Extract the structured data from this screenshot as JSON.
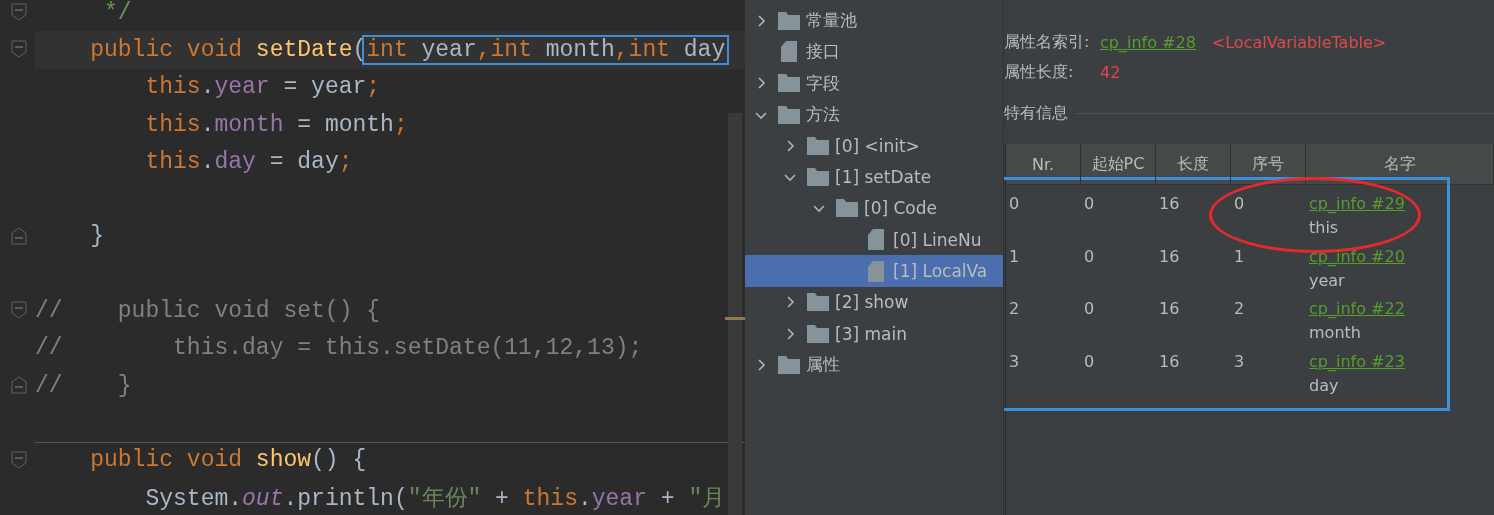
{
  "editor": {
    "lines": [
      {
        "kind": "code",
        "fold_start": true,
        "tokens": [
          {
            "text": "     */",
            "kind": "doc"
          }
        ]
      },
      {
        "kind": "code",
        "fold_start": true,
        "current": true,
        "tokens": [
          {
            "text": "    public void ",
            "kind": "keyword"
          },
          {
            "text": "setDate",
            "kind": "method"
          },
          {
            "text": "(",
            "kind": "plain"
          },
          {
            "kind": "framed",
            "tokens": [
              {
                "text": "int ",
                "kind": "keyword"
              },
              {
                "text": "year",
                "kind": "plain"
              },
              {
                "text": ",",
                "kind": "keyword"
              },
              {
                "text": "int ",
                "kind": "keyword"
              },
              {
                "text": "month",
                "kind": "plain"
              },
              {
                "text": ",",
                "kind": "keyword"
              },
              {
                "text": "int ",
                "kind": "keyword"
              },
              {
                "text": "day",
                "kind": "plain"
              }
            ]
          }
        ]
      },
      {
        "kind": "code",
        "tokens": [
          {
            "text": "        this",
            "kind": "keyword"
          },
          {
            "text": ".",
            "kind": "plain"
          },
          {
            "text": "year",
            "kind": "field"
          },
          {
            "text": " = year",
            "kind": "plain"
          },
          {
            "text": ";",
            "kind": "keyword"
          }
        ]
      },
      {
        "kind": "code",
        "tokens": [
          {
            "text": "        this",
            "kind": "keyword"
          },
          {
            "text": ".",
            "kind": "plain"
          },
          {
            "text": "month",
            "kind": "field"
          },
          {
            "text": " = month",
            "kind": "plain"
          },
          {
            "text": ";",
            "kind": "keyword"
          }
        ]
      },
      {
        "kind": "code",
        "tokens": [
          {
            "text": "        this",
            "kind": "keyword"
          },
          {
            "text": ".",
            "kind": "plain"
          },
          {
            "text": "day",
            "kind": "field"
          },
          {
            "text": " = day",
            "kind": "plain"
          },
          {
            "text": ";",
            "kind": "keyword"
          }
        ]
      },
      {
        "kind": "blank"
      },
      {
        "kind": "code",
        "fold_end": true,
        "tokens": [
          {
            "text": "    }",
            "kind": "plain"
          }
        ]
      },
      {
        "kind": "blank"
      },
      {
        "kind": "code",
        "fold_start": true,
        "tokens": [
          {
            "text": "//    public void set() {",
            "kind": "comment"
          }
        ]
      },
      {
        "kind": "code",
        "tokens": [
          {
            "text": "//        this.day = this.setDate(11,12,13);",
            "kind": "comment"
          }
        ]
      },
      {
        "kind": "code",
        "fold_end": true,
        "tokens": [
          {
            "text": "//    }",
            "kind": "comment"
          }
        ]
      },
      {
        "kind": "blank"
      },
      {
        "kind": "code",
        "fold_start": true,
        "separator": true,
        "tokens": [
          {
            "text": "    public void ",
            "kind": "keyword"
          },
          {
            "text": "show",
            "kind": "method"
          },
          {
            "text": "() {",
            "kind": "plain"
          }
        ]
      },
      {
        "kind": "code",
        "tokens": [
          {
            "text": "        System.",
            "kind": "plain"
          },
          {
            "text": "out",
            "kind": "static"
          },
          {
            "text": ".println(",
            "kind": "plain"
          },
          {
            "text": "\"年份\"",
            "kind": "string"
          },
          {
            "text": " + ",
            "kind": "plain"
          },
          {
            "text": "this",
            "kind": "keyword"
          },
          {
            "text": ".",
            "kind": "plain"
          },
          {
            "text": "year",
            "kind": "field"
          },
          {
            "text": " + ",
            "kind": "plain"
          },
          {
            "text": "\"月",
            "kind": "string"
          }
        ]
      }
    ]
  },
  "tree": [
    {
      "label": "常量池",
      "kind": "folder",
      "expanded": false,
      "selected": false
    },
    {
      "label": "接口",
      "kind": "file",
      "selected": false
    },
    {
      "label": "字段",
      "kind": "folder",
      "expanded": false,
      "selected": false
    },
    {
      "label": "方法",
      "kind": "folder",
      "expanded": true,
      "selected": false,
      "children": [
        {
          "label": "[0] <init>",
          "kind": "folder",
          "expanded": false,
          "selected": false
        },
        {
          "label": "[1] setDate",
          "kind": "folder",
          "expanded": true,
          "selected": false,
          "children": [
            {
              "label": "[0] Code",
              "kind": "folder",
              "expanded": true,
              "selected": false,
              "children": [
                {
                  "label": "[0] LineNu",
                  "kind": "file",
                  "selected": false
                },
                {
                  "label": "[1] LocalVa",
                  "kind": "file",
                  "selected": true
                }
              ]
            }
          ]
        },
        {
          "label": "[2] show",
          "kind": "folder",
          "expanded": false,
          "selected": false
        },
        {
          "label": "[3] main",
          "kind": "folder",
          "expanded": false,
          "selected": false
        }
      ]
    },
    {
      "label": "属性",
      "kind": "folder",
      "expanded": false,
      "selected": false
    }
  ],
  "details": {
    "fields": [
      {
        "label": "属性名索引:",
        "link": "cp_info #28",
        "value": "<LocalVariableTable>"
      },
      {
        "label": "属性长度:",
        "value": "42"
      }
    ],
    "section_title": "特有信息",
    "table": {
      "framed": true,
      "columns": [
        "Nr.",
        "起始PC",
        "长度",
        "序号",
        "名字"
      ],
      "rows": [
        {
          "cells": [
            "0",
            "0",
            "16",
            "0"
          ],
          "name_link": "cp_info #29",
          "name": "this",
          "circled": true
        },
        {
          "cells": [
            "1",
            "0",
            "16",
            "1"
          ],
          "name_link": "cp_info #20",
          "name": "year",
          "circled": false
        },
        {
          "cells": [
            "2",
            "0",
            "16",
            "2"
          ],
          "name_link": "cp_info #22",
          "name": "month",
          "circled": false
        },
        {
          "cells": [
            "3",
            "0",
            "16",
            "3"
          ],
          "name_link": "cp_info #23",
          "name": "day",
          "circled": false
        }
      ]
    }
  }
}
